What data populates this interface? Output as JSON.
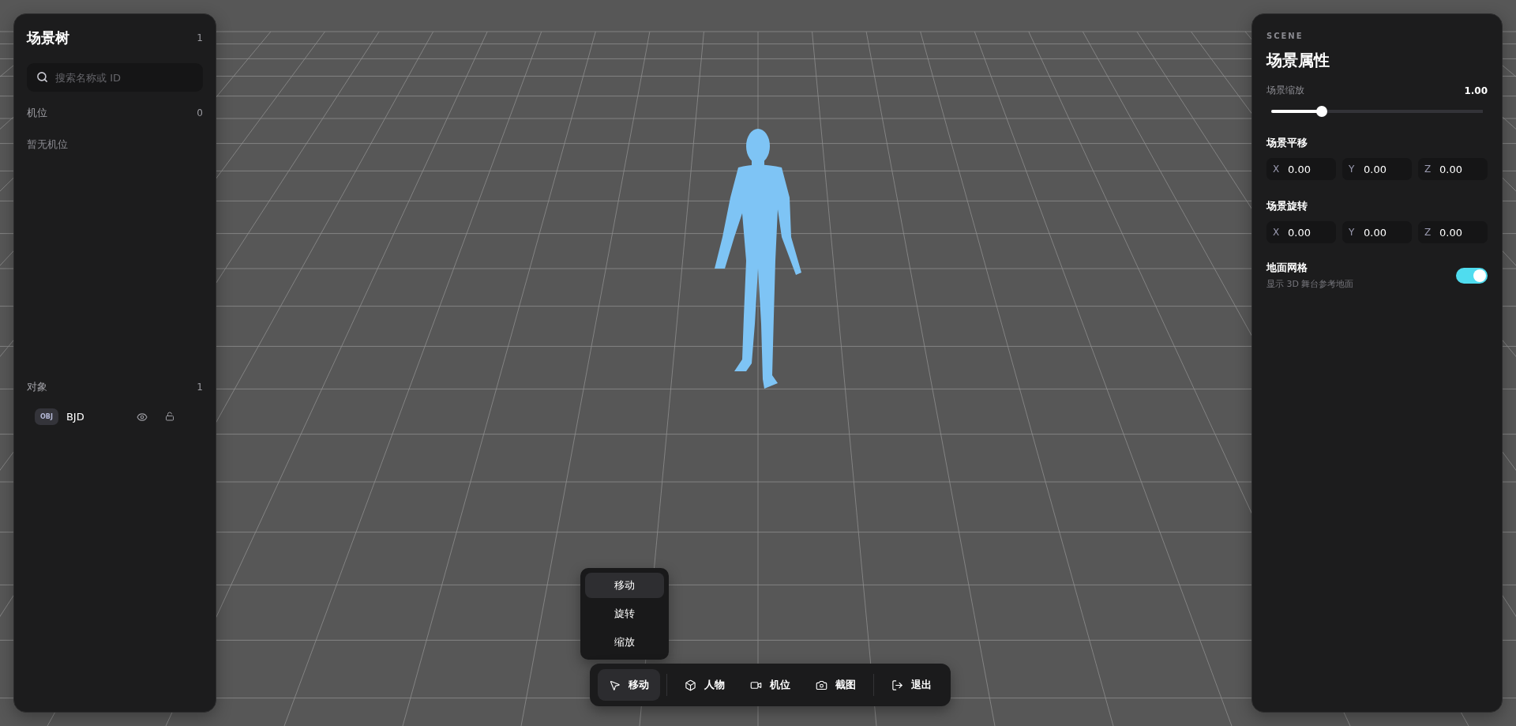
{
  "scene_tree": {
    "title": "场景树",
    "count": "1",
    "search": {
      "placeholder": "搜索名称或 ID"
    },
    "cameras": {
      "title": "机位",
      "count": "0",
      "empty_text": "暂无机位"
    },
    "objects": {
      "title": "对象",
      "count": "1",
      "items": [
        {
          "badge": "OBJ",
          "name": "BJD"
        }
      ]
    }
  },
  "properties": {
    "eyebrow": "SCENE",
    "title": "场景属性",
    "scale": {
      "label": "场景缩放",
      "value": "1.00",
      "level": 0.24
    },
    "translate": {
      "label": "场景平移",
      "fields": [
        {
          "axis": "X",
          "value": "0.00"
        },
        {
          "axis": "Y",
          "value": "0.00"
        },
        {
          "axis": "Z",
          "value": "0.00"
        }
      ]
    },
    "rotate": {
      "label": "场景旋转",
      "fields": [
        {
          "axis": "X",
          "value": "0.00"
        },
        {
          "axis": "Y",
          "value": "0.00"
        },
        {
          "axis": "Z",
          "value": "0.00"
        }
      ]
    },
    "ground_grid": {
      "label": "地面网格",
      "description": "显示 3D 舞台参考地面",
      "on": true
    }
  },
  "transform_menu": [
    {
      "label": "移动",
      "selected": true
    },
    {
      "label": "旋转",
      "selected": false
    },
    {
      "label": "缩放",
      "selected": false
    }
  ],
  "toolbar": [
    [
      {
        "kind": "move",
        "label": "移动",
        "selected": true
      }
    ],
    [
      {
        "kind": "person",
        "label": "人物",
        "selected": false
      },
      {
        "kind": "camera",
        "label": "机位",
        "selected": false
      },
      {
        "kind": "screenshot",
        "label": "截图",
        "selected": false
      }
    ],
    [
      {
        "kind": "exit",
        "label": "退出",
        "selected": false
      }
    ]
  ]
}
